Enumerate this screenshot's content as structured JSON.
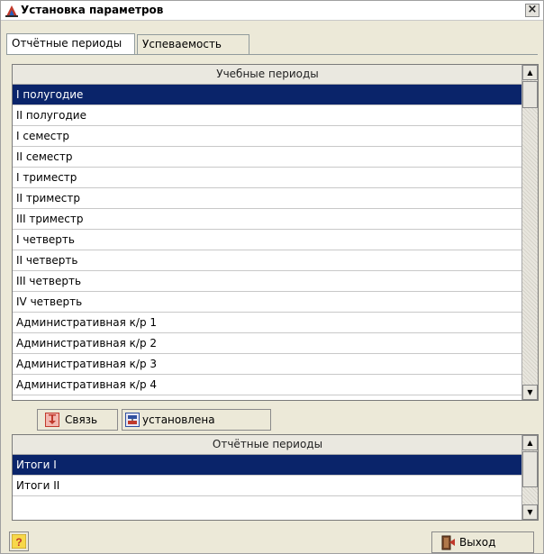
{
  "window": {
    "title": "Установка параметров",
    "close_label": "×"
  },
  "tabs": [
    {
      "label": "Отчётные периоды",
      "active": true
    },
    {
      "label": "Успеваемость",
      "active": false
    }
  ],
  "study_periods": {
    "header": "Учебные периоды",
    "rows": [
      {
        "label": "I полугодие",
        "selected": true
      },
      {
        "label": "II полугодие",
        "selected": false
      },
      {
        "label": "I семестр",
        "selected": false
      },
      {
        "label": "II семестр",
        "selected": false
      },
      {
        "label": "I триместр",
        "selected": false
      },
      {
        "label": "II триместр",
        "selected": false
      },
      {
        "label": "III триместр",
        "selected": false
      },
      {
        "label": "I четверть",
        "selected": false
      },
      {
        "label": "II четверть",
        "selected": false
      },
      {
        "label": "III четверть",
        "selected": false
      },
      {
        "label": "IV четверть",
        "selected": false
      },
      {
        "label": "Административная к/р 1",
        "selected": false
      },
      {
        "label": "Административная к/р 2",
        "selected": false
      },
      {
        "label": "Административная к/р 3",
        "selected": false
      },
      {
        "label": "Административная к/р 4",
        "selected": false
      }
    ]
  },
  "link_bar": {
    "link_label": "Связь",
    "status_label": "установлена"
  },
  "report_periods": {
    "header": "Отчётные периоды",
    "rows": [
      {
        "label": "Итоги I",
        "selected": true
      },
      {
        "label": "Итоги II",
        "selected": false
      }
    ]
  },
  "footer": {
    "help_label": "?",
    "exit_label": "Выход"
  },
  "colors": {
    "selection": "#0a246a",
    "window_bg": "#ece9d8"
  }
}
